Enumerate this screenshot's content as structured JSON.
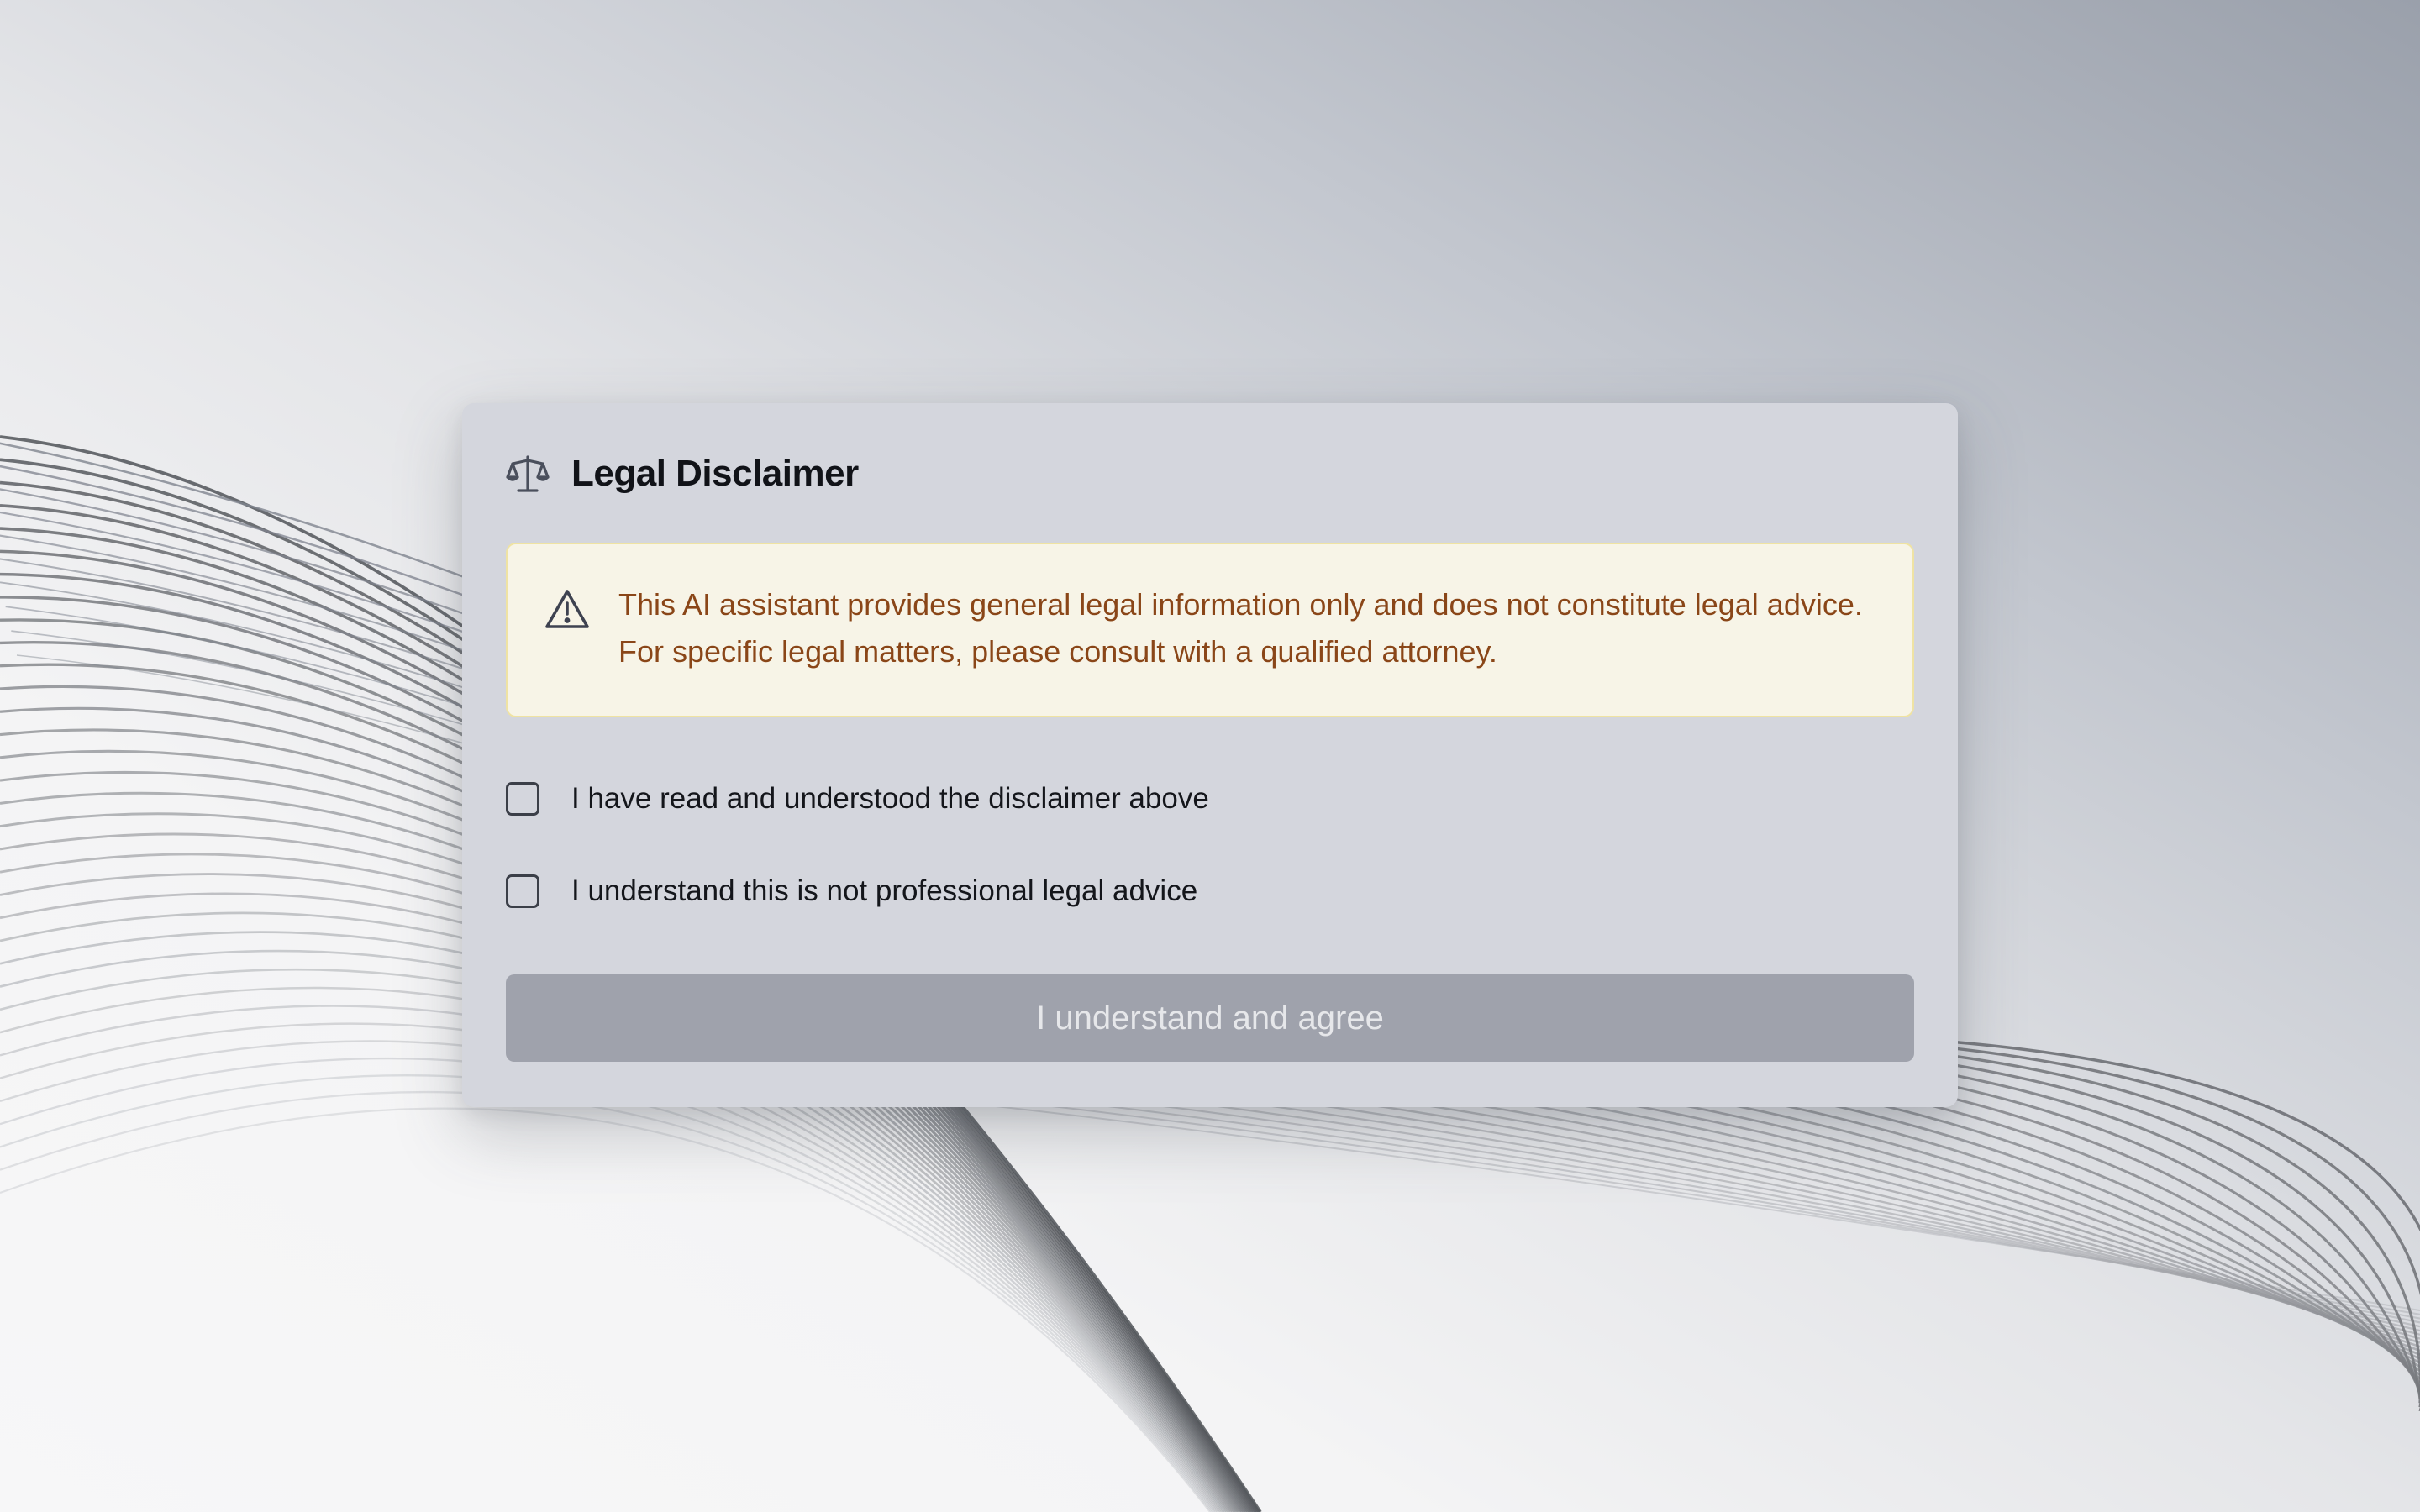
{
  "modal": {
    "title": "Legal Disclaimer",
    "title_icon": "scale-icon",
    "warning": {
      "icon": "warning-triangle-icon",
      "text": "This AI assistant provides general legal information only and does not constitute legal advice. For specific legal matters, please consult with a qualified attorney."
    },
    "checkboxes": [
      {
        "label": "I have read and understood the disclaimer above",
        "checked": false
      },
      {
        "label": "I understand this is not professional legal advice",
        "checked": false
      }
    ],
    "agree_button": {
      "label": "I understand and agree",
      "disabled": true
    }
  },
  "colors": {
    "warning_text": "#8a4618",
    "warning_background": "#f7f4e7",
    "warning_border": "#efe3a3",
    "button_disabled": "#9fa2ac",
    "modal_background": "#d4d6dd"
  }
}
